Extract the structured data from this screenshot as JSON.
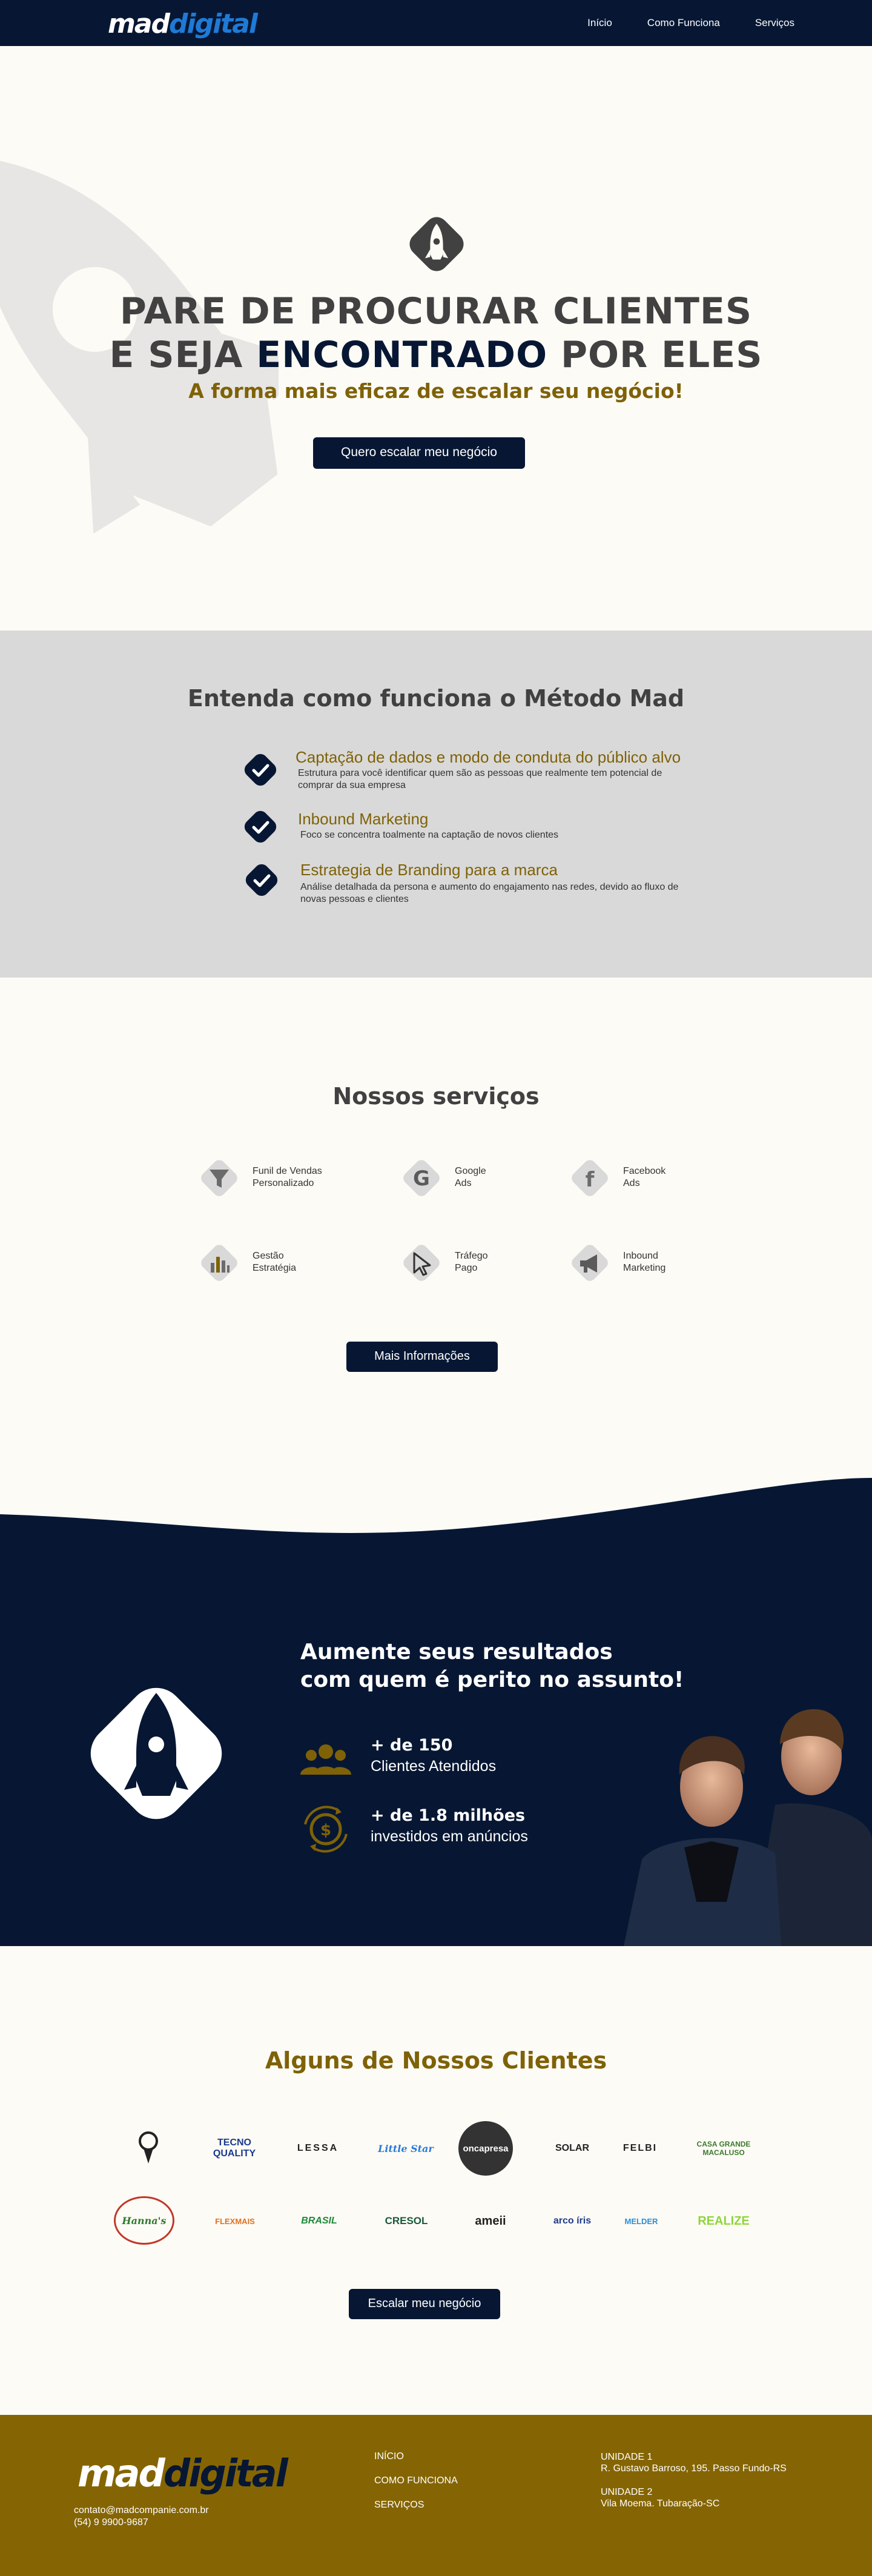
{
  "nav": {
    "logo_part1": "mad",
    "logo_part2": "digital",
    "links": [
      "Início",
      "Como Funciona",
      "Serviços"
    ]
  },
  "hero": {
    "title_line1": "PARE DE PROCURAR CLIENTES",
    "title_line2_pre": "E SEJA ",
    "title_line2_highlight": "ENCONTRADO",
    "title_line2_post": " POR ELES",
    "subtitle": "A forma mais eficaz de escalar seu negócio!",
    "cta": "Quero escalar meu negócio"
  },
  "method": {
    "title": "Entenda como funciona o Método Mad",
    "items": [
      {
        "title": "Captação de dados e modo de conduta do público alvo",
        "desc": "Estrutura para você identificar quem são as pessoas que realmente tem potencial de comprar da sua empresa"
      },
      {
        "title": "Inbound Marketing",
        "desc": "Foco se concentra toalmente na captação de novos clientes"
      },
      {
        "title": "Estrategia de Branding para a marca",
        "desc": "Análise detalhada da persona e aumento do engajamento nas redes, devido ao fluxo de novas pessoas e clientes"
      }
    ]
  },
  "services": {
    "title": "Nossos serviços",
    "items": [
      {
        "label": "Funil de Vendas\nPersonalizado",
        "icon": "funnel-icon"
      },
      {
        "label": "Google\nAds",
        "icon": "google-icon"
      },
      {
        "label": "Facebook\nAds",
        "icon": "facebook-icon"
      },
      {
        "label": "Gestão\nEstratégia",
        "icon": "chart-icon"
      },
      {
        "label": "Tráfego\nPago",
        "icon": "cursor-icon"
      },
      {
        "label": "Inbound\nMarketing",
        "icon": "megaphone-icon"
      }
    ],
    "cta": "Mais Informações"
  },
  "results": {
    "title_line1": "Aumente seus resultados",
    "title_line2": "com quem é perito no assunto!",
    "stats": [
      {
        "value": "+ de 150",
        "label": "Clientes Atendidos",
        "icon": "people-icon"
      },
      {
        "value": "+ de 1.8 milhões",
        "label": "investidos em anúncios",
        "icon": "money-icon"
      }
    ]
  },
  "clients": {
    "title": "Alguns de Nossos Clientes",
    "logos": [
      {
        "name": "",
        "color": "#222222"
      },
      {
        "name": "TECNO QUALITY",
        "color": "#1b3a8c"
      },
      {
        "name": "LESSA",
        "color": "#222222"
      },
      {
        "name": "Little Star",
        "color": "#2b7bd6"
      },
      {
        "name": "oncapresa",
        "color": "#ffffff"
      },
      {
        "name": "SOLAR",
        "color": "#222222"
      },
      {
        "name": "FELBI",
        "color": "#222222"
      },
      {
        "name": "CASA GRANDE MACALUSO",
        "color": "#3a7a2a"
      },
      {
        "name": "Hanna's",
        "color": "#2f7a2f"
      },
      {
        "name": "FLEXMAIS",
        "color": "#e07020"
      },
      {
        "name": "BRASIL",
        "color": "#1e8a3a"
      },
      {
        "name": "CRESOL",
        "color": "#1a5a3a"
      },
      {
        "name": "ameii",
        "color": "#222222"
      },
      {
        "name": "arco íris",
        "color": "#1e3a8a"
      },
      {
        "name": "MELDER",
        "color": "#2b8fd6"
      },
      {
        "name": "REALIZE",
        "color": "#8fd63a"
      }
    ],
    "cta": "Escalar meu negócio"
  },
  "footer": {
    "logo_part1": "mad",
    "logo_part2": "digital",
    "email": "contato@madcompanie.com.br",
    "phone": "(54) 9 9900-9687",
    "links": [
      "INÍCIO",
      "COMO FUNCIONA",
      "SERVIÇOS"
    ],
    "unit1_title": "UNIDADE 1",
    "unit1_addr": "R. Gustavo Barroso, 195. Passo Fundo-RS",
    "unit2_title": "UNIDADE 2",
    "unit2_addr": "Vila Moema. Tubaração-SC"
  },
  "colors": {
    "navy": "#071733",
    "gold": "#7f6207",
    "footer_gold": "#856503",
    "gray_section": "#d9d9d9",
    "cream": "#fdfbf6"
  }
}
